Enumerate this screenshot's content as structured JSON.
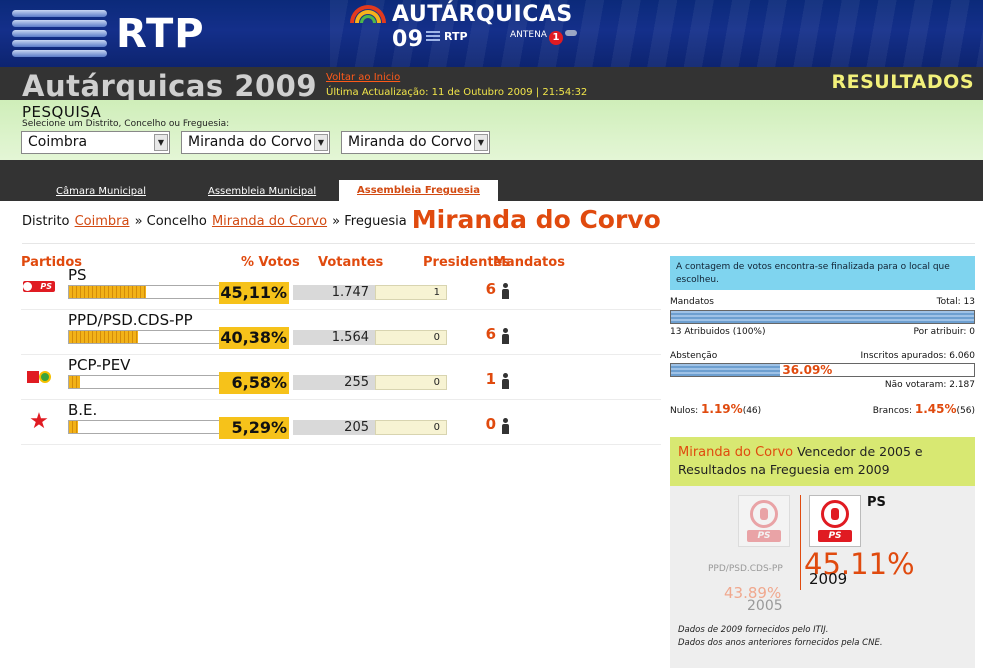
{
  "header": {
    "rtp": "RTP",
    "event": "AUTÁRQUICAS 09",
    "sub_rtp": "RTP",
    "sub_antena": "ANTENA",
    "sub_antena_num": "1"
  },
  "titlebar": {
    "title": "Autárquicas 2009",
    "back_link": "Voltar ao Inicio",
    "updated": "Última Actualização: 11 de Outubro 2009 | 21:54:32",
    "results": "RESULTADOS"
  },
  "search": {
    "label": "PESQUISA",
    "hint": "Selecione um Distrito, Concelho ou Freguesia:",
    "district": "Coimbra",
    "council": "Miranda do Corvo",
    "parish": "Miranda do Corvo"
  },
  "tabs": [
    "Câmara Municipal",
    "Assembleia Municipal",
    "Assembleia Freguesia"
  ],
  "breadcrumb": {
    "d_label": "Distrito",
    "district": "Coimbra",
    "c_label": "» Concelho",
    "council": "Miranda do Corvo",
    "f_label": "» Freguesia",
    "parish": "Miranda do Corvo"
  },
  "table": {
    "headers": {
      "partidos": "Partidos",
      "votos": "% Votos",
      "votantes": "Votantes",
      "presidentes": "Presidentes",
      "mandatos": "Mandatos"
    },
    "rows": [
      {
        "name": "PS",
        "pct": "45,11%",
        "share": 0.4511,
        "votantes": "1.747",
        "presidentes": "1",
        "mandatos": "6",
        "logo": "ps-logo"
      },
      {
        "name": "PPD/PSD.CDS-PP",
        "pct": "40,38%",
        "share": 0.4038,
        "votantes": "1.564",
        "presidentes": "0",
        "mandatos": "6",
        "logo": ""
      },
      {
        "name": "PCP-PEV",
        "pct": "6,58%",
        "share": 0.0658,
        "votantes": "255",
        "presidentes": "0",
        "mandatos": "1",
        "logo": "cdu-logo"
      },
      {
        "name": "B.E.",
        "pct": "5,29%",
        "share": 0.0529,
        "votantes": "205",
        "presidentes": "0",
        "mandatos": "0",
        "logo": "be-logo"
      }
    ]
  },
  "panel": {
    "notice": "A contagem de votos encontra-se finalizada para o local que escolheu.",
    "mandatos_label": "Mandatos",
    "mandatos_total": "Total: 13",
    "mandatos_fill": 1.0,
    "atribuidos": "13 Atribuidos (100%)",
    "por_atribuir": "Por atribuir: 0",
    "abstencao_label": "Abstenção",
    "inscritos": "Inscritos apurados: 6.060",
    "abstencao_pct": "36.09%",
    "abstencao_fill": 0.3609,
    "nao_votaram": "Não votaram: 2.187",
    "nulos_label": "Nulos:",
    "nulos_pct": "1.19%",
    "nulos_n": "(46)",
    "brancos_label": "Brancos:",
    "brancos_pct": "1.45%",
    "brancos_n": "(56)"
  },
  "winner": {
    "place": "Miranda do Corvo",
    "text": "Vencedor de 2005 e Resultados na Freguesia em 2009",
    "old_party": "PPD/PSD.CDS-PP",
    "old_pct": "43.89%",
    "old_year": "2005",
    "new_party": "PS",
    "new_pct": "45.11%",
    "new_year": "2009",
    "logo_text": "PS",
    "note1": "Dados de 2009 fornecidos pelo ITIJ.",
    "note2": "Dados dos anos anteriores fornecidos pela CNE."
  },
  "colors": {
    "accent": "#e04a0e",
    "header_blue": "#0b2a7a",
    "bar_gold": "#f6c21a",
    "search_green": "#d4f0c0",
    "winner_lime": "#d8e872"
  }
}
